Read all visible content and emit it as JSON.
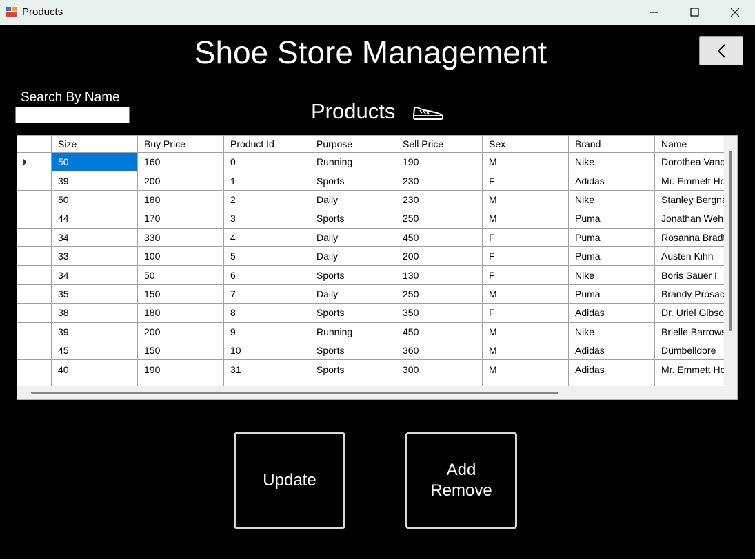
{
  "window": {
    "title": "Products"
  },
  "header": {
    "title": "Shoe Store Management"
  },
  "search": {
    "label": "Search By Name",
    "value": ""
  },
  "section": {
    "title": "Products",
    "icon": "shoe-icon"
  },
  "table": {
    "columns": [
      "Size",
      "Buy Price",
      "Product Id",
      "Purpose",
      "Sell Price",
      "Sex",
      "Brand",
      "Name"
    ],
    "rows": [
      [
        "50",
        "160",
        "0",
        "Running",
        "190",
        "M",
        "Nike",
        "Dorothea Vande"
      ],
      [
        "39",
        "200",
        "1",
        "Sports",
        "230",
        "F",
        "Adidas",
        "Mr. Emmett Hom"
      ],
      [
        "50",
        "180",
        "2",
        "Daily",
        "230",
        "M",
        "Nike",
        "Stanley Bergnau"
      ],
      [
        "44",
        "170",
        "3",
        "Sports",
        "250",
        "M",
        "Puma",
        "Jonathan Wehn"
      ],
      [
        "34",
        "330",
        "4",
        "Daily",
        "450",
        "F",
        "Puma",
        "Rosanna Bradtk"
      ],
      [
        "33",
        "100",
        "5",
        "Daily",
        "200",
        "F",
        "Puma",
        "Austen Kihn"
      ],
      [
        "34",
        "50",
        "6",
        "Sports",
        "130",
        "F",
        "Nike",
        "Boris Sauer I"
      ],
      [
        "35",
        "150",
        "7",
        "Daily",
        "250",
        "M",
        "Puma",
        "Brandy Prosacc"
      ],
      [
        "38",
        "180",
        "8",
        "Sports",
        "350",
        "F",
        "Adidas",
        "Dr. Uriel Gibson"
      ],
      [
        "39",
        "200",
        "9",
        "Running",
        "450",
        "M",
        "Nike",
        "Brielle Barrows D"
      ],
      [
        "45",
        "150",
        "10",
        "Sports",
        "360",
        "M",
        "Adidas",
        "Dumbelldore"
      ],
      [
        "40",
        "190",
        "31",
        "Sports",
        "300",
        "M",
        "Adidas",
        "Mr. Emmett Hom"
      ]
    ]
  },
  "buttons": {
    "update": "Update",
    "add_remove_line1": "Add",
    "add_remove_line2": "Remove"
  },
  "colors": {
    "background": "#000000",
    "selection": "#0078d7",
    "titlebar": "#e9f1ee"
  }
}
